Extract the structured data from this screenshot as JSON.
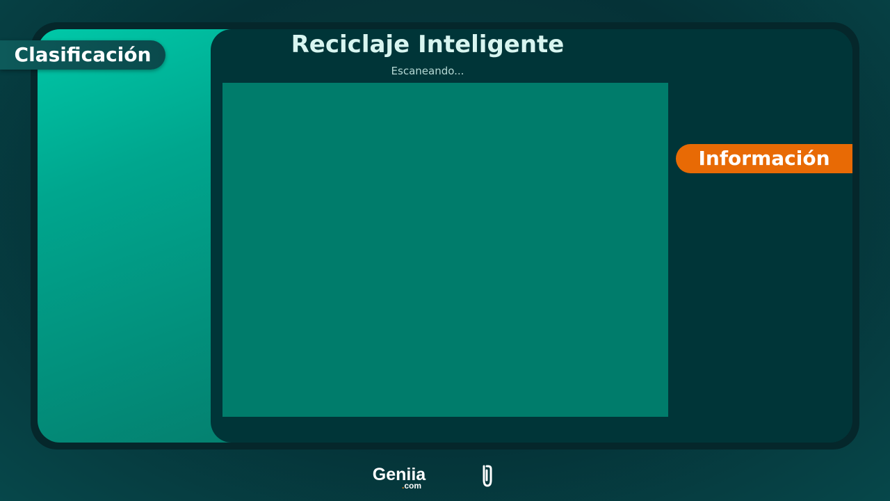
{
  "app": {
    "title": "Reciclaje Inteligente",
    "status": "Escaneando..."
  },
  "tabs": {
    "left_label": "Clasificación",
    "right_label": "Información"
  },
  "footer": {
    "brand": "Geniia",
    "domain_dot": ".",
    "domain": "com",
    "icon": "paperclip-icon"
  },
  "colors": {
    "accent_orange": "#e86a05",
    "scan_area": "#007c6b",
    "panel_dark": "#003538",
    "teal_gradient_start": "#00c8a8"
  }
}
